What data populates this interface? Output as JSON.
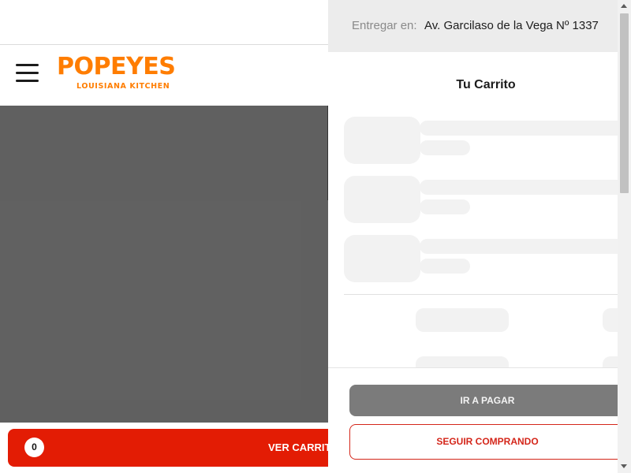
{
  "header": {
    "brand_name": "POPEYES",
    "brand_tagline": "LOUISIANA KITCHEN",
    "brand_color": "#ff7d00",
    "menu_icon": "hamburger-menu-icon"
  },
  "footer": {
    "cart_count": "0",
    "view_cart_label": "VER CARRITO",
    "button_color": "#e31c04"
  },
  "cart": {
    "deliver_label": "Entregar en:",
    "deliver_address": "Av. Garcilaso de la Vega Nº 1337",
    "title": "Tu Carrito",
    "loading": true,
    "checkout_label": "IR A PAGAR",
    "continue_label": "SEGUIR COMPRANDO",
    "accent_color": "#d4261a"
  }
}
